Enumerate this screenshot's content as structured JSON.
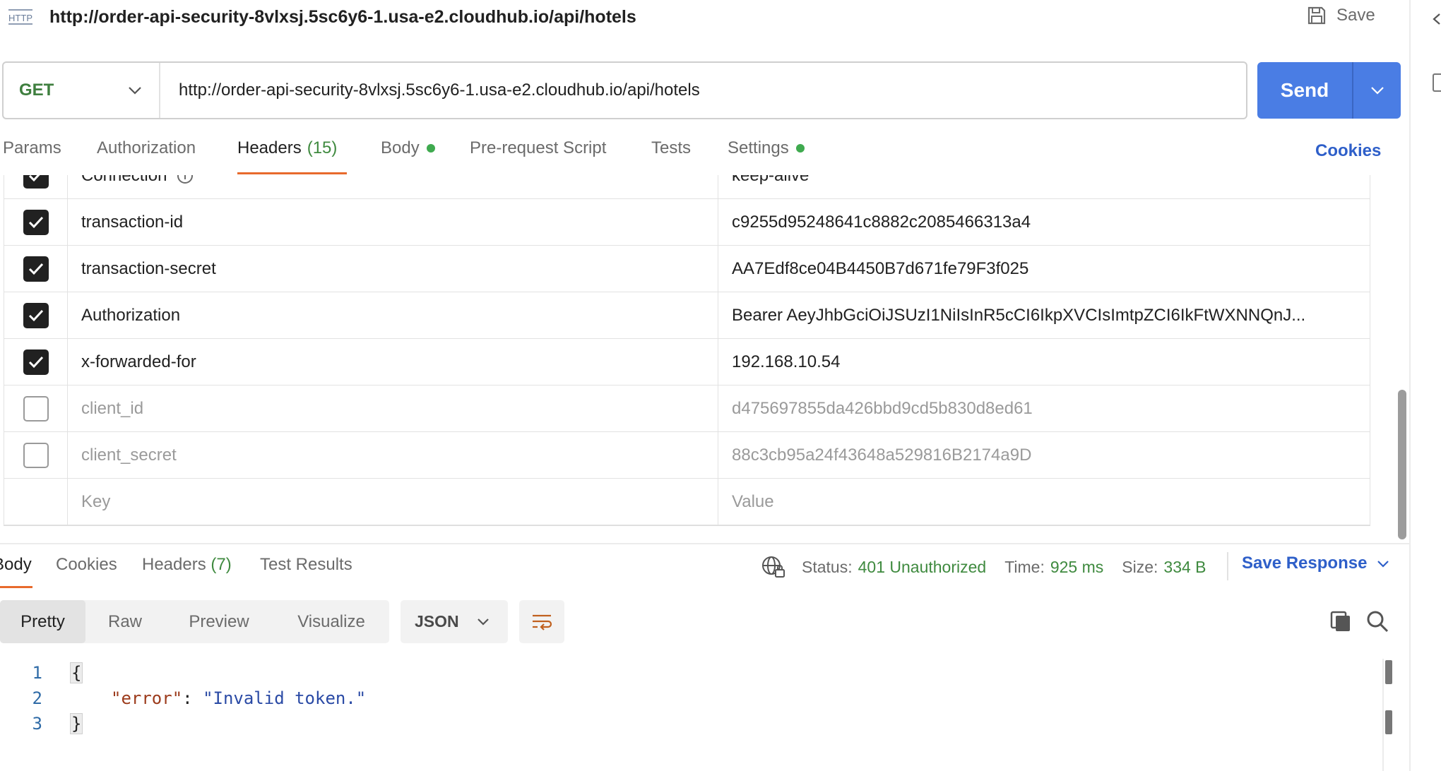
{
  "request": {
    "title": "http://order-api-security-8vlxsj.5sc6y6-1.usa-e2.cloudhub.io/api/hotels",
    "save_label": "Save",
    "method": "GET",
    "url": "http://order-api-security-8vlxsj.5sc6y6-1.usa-e2.cloudhub.io/api/hotels",
    "send_label": "Send"
  },
  "request_tabs": {
    "params": "Params",
    "authorization": "Authorization",
    "headers": "Headers",
    "headers_count": "(15)",
    "body": "Body",
    "prerequest": "Pre-request Script",
    "tests": "Tests",
    "settings": "Settings",
    "cookies": "Cookies"
  },
  "headers": [
    {
      "key": "Connection",
      "value": "keep-alive",
      "enabled": true
    },
    {
      "key": "transaction-id",
      "value": "c9255d95248641c8882c2085466313a4",
      "enabled": true
    },
    {
      "key": "transaction-secret",
      "value": "AA7Edf8ce04B4450B7d671fe79F3f025",
      "enabled": true
    },
    {
      "key": "Authorization",
      "value": "Bearer AeyJhbGciOiJSUzI1NiIsInR5cCI6IkpXVCIsImtpZCI6IkFtWXNNQnJ...",
      "enabled": true
    },
    {
      "key": "x-forwarded-for",
      "value": "192.168.10.54",
      "enabled": true
    },
    {
      "key": "client_id",
      "value": "d475697855da426bbd9cd5b830d8ed61",
      "enabled": false
    },
    {
      "key": "client_secret",
      "value": "88c3cb95a24f43648a529816B2174a9D",
      "enabled": false
    }
  ],
  "headers_placeholder": {
    "key": "Key",
    "value": "Value"
  },
  "response_tabs": {
    "body": "Body",
    "cookies": "Cookies",
    "headers": "Headers",
    "headers_count": "(7)",
    "test_results": "Test Results"
  },
  "response_status": {
    "status_label": "Status:",
    "status_value": "401 Unauthorized",
    "time_label": "Time:",
    "time_value": "925 ms",
    "size_label": "Size:",
    "size_value": "334 B",
    "save_response": "Save Response"
  },
  "view_modes": [
    "Pretty",
    "Raw",
    "Preview",
    "Visualize"
  ],
  "format": "JSON",
  "code": {
    "lines": [
      "1",
      "2",
      "3"
    ],
    "open": "{",
    "key": "\"error\"",
    "colon": ": ",
    "value": "\"Invalid token.\"",
    "close": "}"
  },
  "colors": {
    "accent": "#4a7de4",
    "tab_underline": "#e86a2c",
    "status_ok": "#3f8a3f",
    "link": "#2e5fc9"
  },
  "icons": [
    "http-icon",
    "save-icon",
    "chevron-down-icon",
    "globe-lock-icon",
    "wrap-lines-icon",
    "copy-icon",
    "search-icon",
    "checkmark-icon",
    "info-icon"
  ]
}
